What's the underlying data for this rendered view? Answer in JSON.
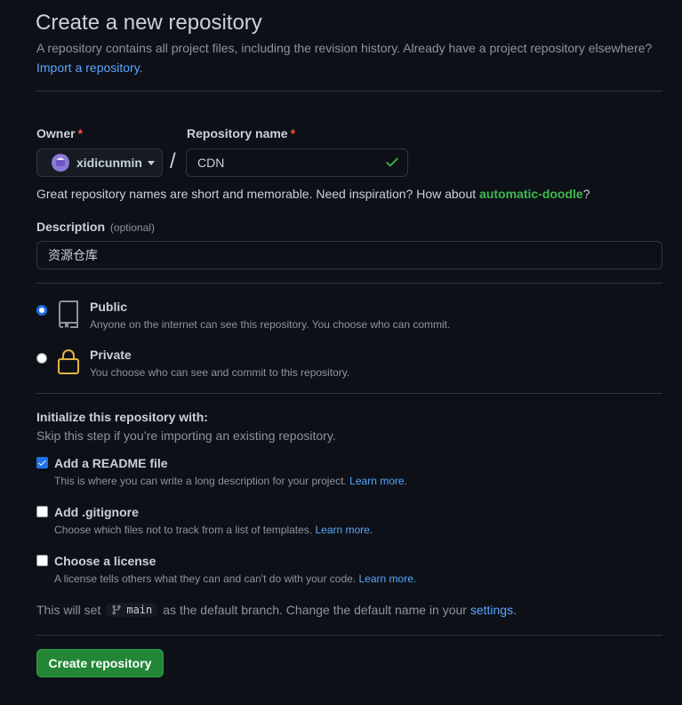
{
  "header": {
    "title": "Create a new repository",
    "subtitle": "A repository contains all project files, including the revision history. Already have a project repository elsewhere?",
    "import_link": "Import a repository."
  },
  "owner": {
    "label": "Owner",
    "required_mark": "*",
    "value": "xidicunmin"
  },
  "separator": "/",
  "repo_name": {
    "label": "Repository name",
    "required_mark": "*",
    "value": "CDN"
  },
  "hint": {
    "prefix": "Great repository names are short and memorable. Need inspiration? How about ",
    "suggestion": "automatic-doodle",
    "suffix": "?"
  },
  "description": {
    "label": "Description",
    "optional": "(optional)",
    "value": "资源仓库"
  },
  "visibility": {
    "public": {
      "title": "Public",
      "desc": "Anyone on the internet can see this repository. You choose who can commit.",
      "selected": true
    },
    "private": {
      "title": "Private",
      "desc": "You choose who can see and commit to this repository.",
      "selected": false
    }
  },
  "init": {
    "heading": "Initialize this repository with:",
    "subheading": "Skip this step if you’re importing an existing repository.",
    "readme": {
      "title": "Add a README file",
      "desc": "This is where you can write a long description for your project.",
      "link": "Learn more.",
      "checked": true
    },
    "gitignore": {
      "title": "Add .gitignore",
      "desc": "Choose which files not to track from a list of templates.",
      "link": "Learn more.",
      "checked": false
    },
    "license": {
      "title": "Choose a license",
      "desc": "A license tells others what they can and can't do with your code.",
      "link": "Learn more.",
      "checked": false
    }
  },
  "branch": {
    "prefix": "This will set",
    "name": "main",
    "middle": "as the default branch. Change the default name in your",
    "link": "settings",
    "suffix": "."
  },
  "submit": {
    "label": "Create repository"
  },
  "colors": {
    "background": "#0d1117",
    "accent_link": "#58a6ff",
    "success": "#3fb950",
    "primary_button": "#238636",
    "required": "#f85149"
  },
  "icons": [
    "check-icon",
    "caret-down-icon",
    "book-repo-icon",
    "lock-icon",
    "git-branch-icon",
    "avatar"
  ]
}
